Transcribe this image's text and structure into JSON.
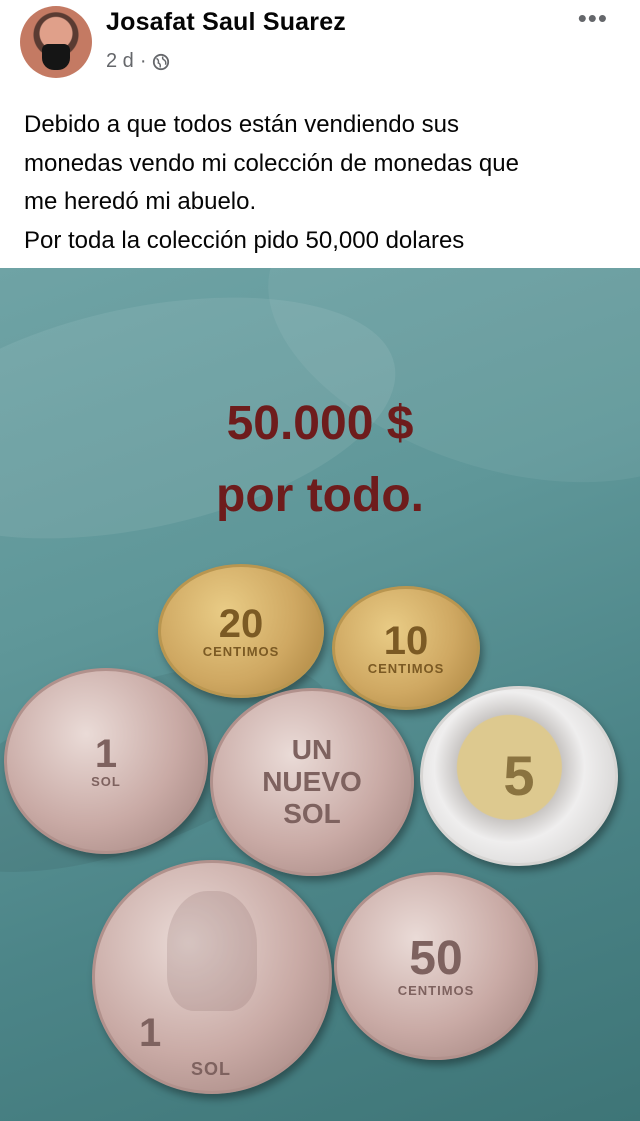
{
  "post": {
    "author": "Josafat Saul Suarez",
    "time": "2 d",
    "separator": "·",
    "privacy_icon": "globe-icon",
    "more_icon": "more-options-icon",
    "more_glyph": "•••",
    "text_lines": [
      "Debido a que todos están vendiendo sus",
      "monedas vendo mi colección de monedas que",
      "me heredó mi abuelo.",
      "Por toda la colección pido 50,000 dolares"
    ]
  },
  "photo": {
    "overlay_line1": "50.000 $",
    "overlay_line2": "por todo.",
    "coins": {
      "c1": {
        "denom": "20",
        "label": "CENTIMOS"
      },
      "c2": {
        "denom": "10",
        "label": "CENTIMOS"
      },
      "c3": {
        "denom": "1",
        "label": "SOL"
      },
      "c4": {
        "denom": "UN NUEVO SOL",
        "label": ""
      },
      "c5": {
        "denom": "5",
        "label": ""
      },
      "c6": {
        "denom": "1",
        "label": "SOL"
      },
      "c7": {
        "denom": "50",
        "label": "CENTIMOS"
      }
    }
  },
  "colors": {
    "overlay_text": "#6e1c1c",
    "cloth": "#5f9799"
  }
}
